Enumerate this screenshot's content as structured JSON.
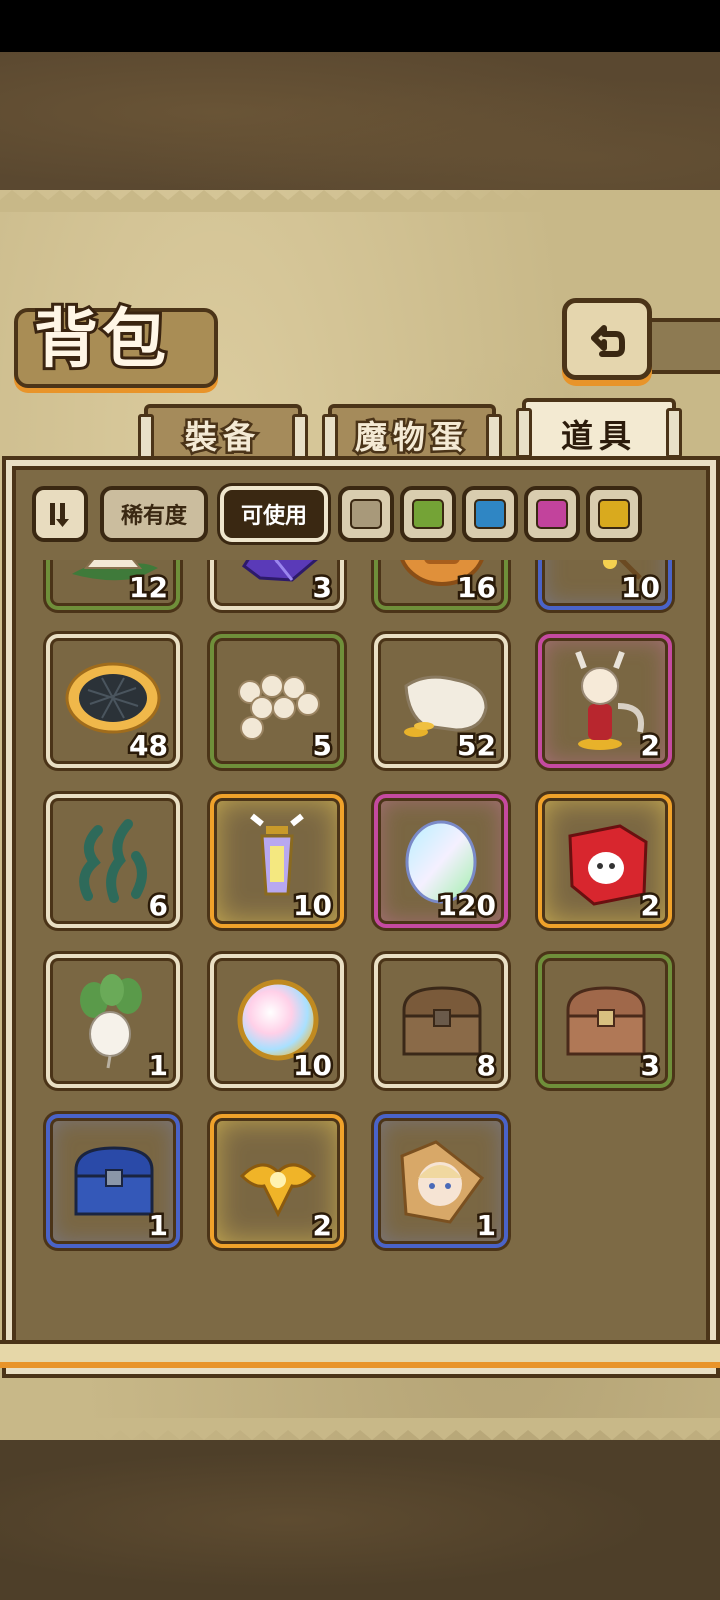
{
  "title": "背包",
  "tabs": [
    {
      "label": "裝备",
      "active": false
    },
    {
      "label": "魔物蛋",
      "active": false
    },
    {
      "label": "道具",
      "active": true
    }
  ],
  "filters": {
    "sort_icon": "sort-toggle-icon",
    "rarity_label": "稀有度",
    "usable_label": "可使用",
    "rarity_colors": [
      "#a8997a",
      "#74a336",
      "#2f86c4",
      "#c2439c",
      "#d9aa1e"
    ]
  },
  "items": [
    {
      "icon": "rice-dumpling-icon",
      "count": "12",
      "rarity": "green"
    },
    {
      "icon": "purple-crystal-icon",
      "count": "3",
      "rarity": "white"
    },
    {
      "icon": "mooncake-icon",
      "count": "16",
      "rarity": "green"
    },
    {
      "icon": "golden-flower-branch-icon",
      "count": "10",
      "rarity": "blue"
    },
    {
      "icon": "nori-pie-icon",
      "count": "48",
      "rarity": "white"
    },
    {
      "icon": "rice-balls-icon",
      "count": "5",
      "rarity": "green"
    },
    {
      "icon": "gold-coin-bag-icon",
      "count": "52",
      "rarity": "white"
    },
    {
      "icon": "character-figurine-icon",
      "count": "2",
      "rarity": "pink"
    },
    {
      "icon": "seaweed-icon",
      "count": "6",
      "rarity": "white"
    },
    {
      "icon": "winged-lantern-icon",
      "count": "10",
      "rarity": "gold"
    },
    {
      "icon": "rainbow-egg-icon",
      "count": "120",
      "rarity": "pink"
    },
    {
      "icon": "ghost-gift-box-icon",
      "count": "2",
      "rarity": "gold"
    },
    {
      "icon": "white-radish-icon",
      "count": "1",
      "rarity": "white"
    },
    {
      "icon": "rainbow-orb-icon",
      "count": "10",
      "rarity": "white"
    },
    {
      "icon": "wooden-chest-icon",
      "count": "8",
      "rarity": "white"
    },
    {
      "icon": "copper-chest-icon",
      "count": "3",
      "rarity": "green"
    },
    {
      "icon": "blue-chest-icon",
      "count": "1",
      "rarity": "blue"
    },
    {
      "icon": "golden-winged-emblem-icon",
      "count": "2",
      "rarity": "gold"
    },
    {
      "icon": "portrait-puzzle-piece-icon",
      "count": "1",
      "rarity": "blue"
    }
  ]
}
